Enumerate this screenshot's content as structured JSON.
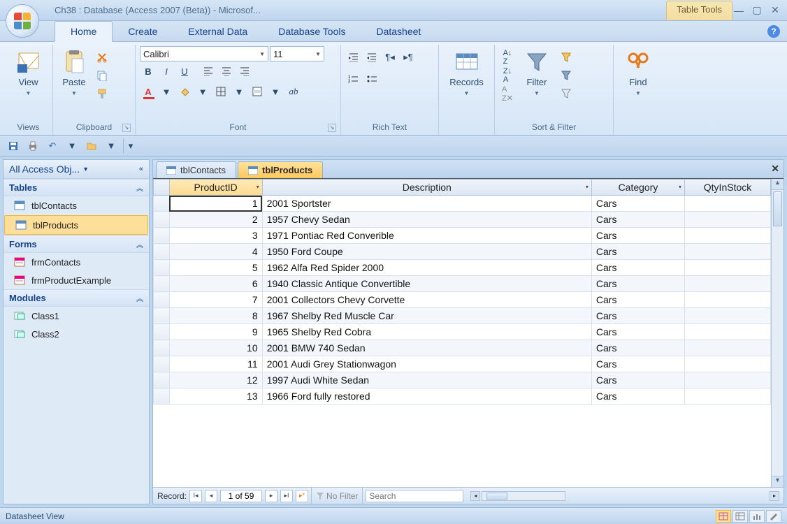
{
  "window": {
    "title": "Ch38 : Database (Access 2007 (Beta)) - Microsof...",
    "contextual_tab": "Table Tools"
  },
  "ribbon": {
    "tabs": [
      "Home",
      "Create",
      "External Data",
      "Database Tools",
      "Datasheet"
    ],
    "active_tab": "Home",
    "font_name": "Calibri",
    "font_size": "11",
    "groups": {
      "views": "Views",
      "clipboard": "Clipboard",
      "font": "Font",
      "richtext": "Rich Text",
      "records": "Records",
      "sortfilter": "Sort & Filter",
      "find": "Find"
    },
    "buttons": {
      "view": "View",
      "paste": "Paste",
      "records": "Records",
      "filter": "Filter",
      "find": "Find"
    }
  },
  "nav": {
    "header": "All Access Obj...",
    "cats": {
      "tables": "Tables",
      "forms": "Forms",
      "modules": "Modules"
    },
    "tables": [
      "tblContacts",
      "tblProducts"
    ],
    "forms": [
      "frmContacts",
      "frmProductExample"
    ],
    "modules": [
      "Class1",
      "Class2"
    ]
  },
  "doc_tabs": [
    {
      "label": "tblContacts",
      "active": false
    },
    {
      "label": "tblProducts",
      "active": true
    }
  ],
  "grid": {
    "columns": [
      "ProductID",
      "Description",
      "Category",
      "QtyInStock"
    ],
    "rows": [
      {
        "ProductID": "1",
        "Description": "2001 Sportster",
        "Category": "Cars",
        "QtyInStock": ""
      },
      {
        "ProductID": "2",
        "Description": "1957 Chevy Sedan",
        "Category": "Cars",
        "QtyInStock": ""
      },
      {
        "ProductID": "3",
        "Description": "1971 Pontiac Red Converible",
        "Category": "Cars",
        "QtyInStock": ""
      },
      {
        "ProductID": "4",
        "Description": "1950 Ford Coupe",
        "Category": "Cars",
        "QtyInStock": ""
      },
      {
        "ProductID": "5",
        "Description": "1962 Alfa Red Spider 2000",
        "Category": "Cars",
        "QtyInStock": ""
      },
      {
        "ProductID": "6",
        "Description": "1940 Classic Antique Convertible",
        "Category": "Cars",
        "QtyInStock": ""
      },
      {
        "ProductID": "7",
        "Description": "2001 Collectors Chevy Corvette",
        "Category": "Cars",
        "QtyInStock": ""
      },
      {
        "ProductID": "8",
        "Description": "1967 Shelby Red Muscle Car",
        "Category": "Cars",
        "QtyInStock": ""
      },
      {
        "ProductID": "9",
        "Description": "1965 Shelby Red Cobra",
        "Category": "Cars",
        "QtyInStock": ""
      },
      {
        "ProductID": "10",
        "Description": "2001 BMW 740 Sedan",
        "Category": "Cars",
        "QtyInStock": ""
      },
      {
        "ProductID": "11",
        "Description": "2001 Audi Grey Stationwagon",
        "Category": "Cars",
        "QtyInStock": ""
      },
      {
        "ProductID": "12",
        "Description": "1997 Audi White Sedan",
        "Category": "Cars",
        "QtyInStock": ""
      },
      {
        "ProductID": "13",
        "Description": "1966 Ford fully restored",
        "Category": "Cars",
        "QtyInStock": ""
      }
    ]
  },
  "record_nav": {
    "label": "Record:",
    "position": "1 of 59",
    "nofilter": "No Filter",
    "search_placeholder": "Search"
  },
  "status": {
    "text": "Datasheet View"
  }
}
